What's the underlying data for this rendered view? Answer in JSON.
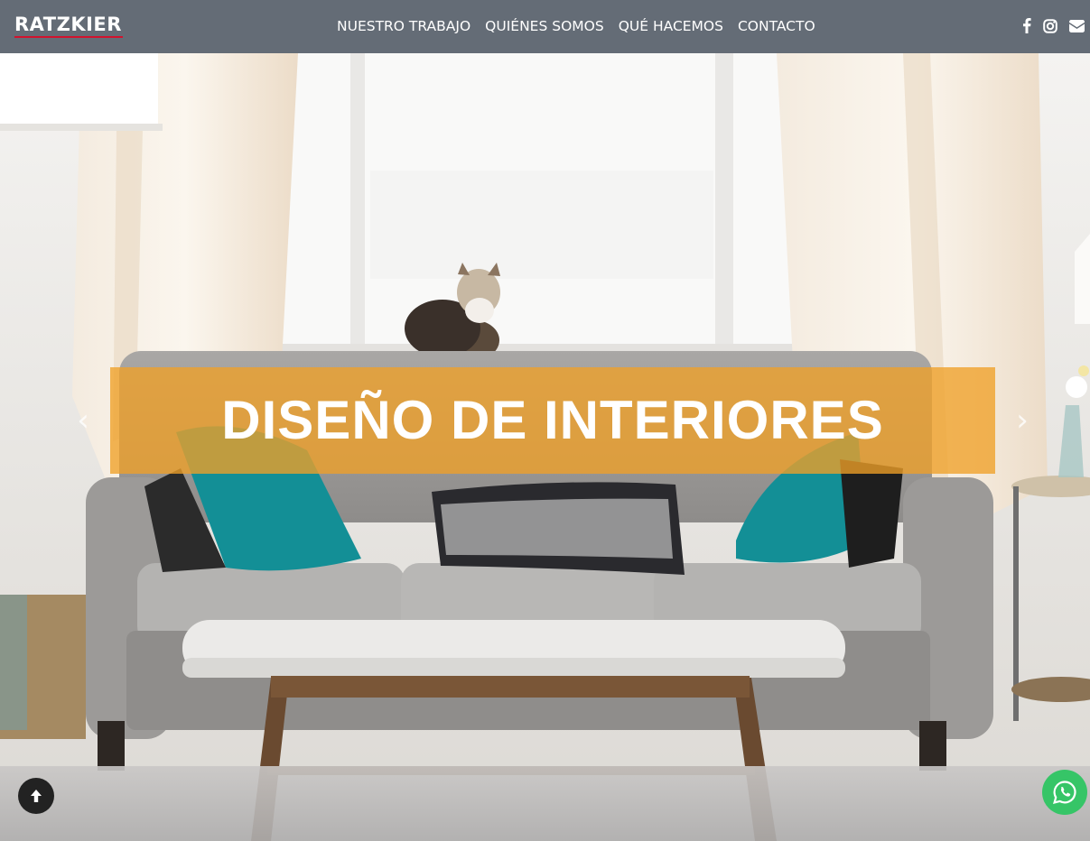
{
  "header": {
    "logo_text": "RATZKIER",
    "nav": [
      "NUESTRO TRABAJO",
      "QUIÉNES SOMOS",
      "QUÉ HACEMOS",
      "CONTACTO"
    ],
    "social_icons": [
      "facebook-icon",
      "instagram-icon",
      "envelope-icon"
    ]
  },
  "hero": {
    "title": "DISEÑO DE INTERIORES",
    "prev_glyph": "‹",
    "next_glyph": "›",
    "banner_color": "#efa028"
  },
  "floating": {
    "scroll_top_icon": "arrow-up-icon",
    "whatsapp_icon": "whatsapp-icon",
    "whatsapp_color": "#36c567"
  },
  "colors": {
    "header_bg": "#646c76",
    "logo_accent": "#d2122e"
  }
}
